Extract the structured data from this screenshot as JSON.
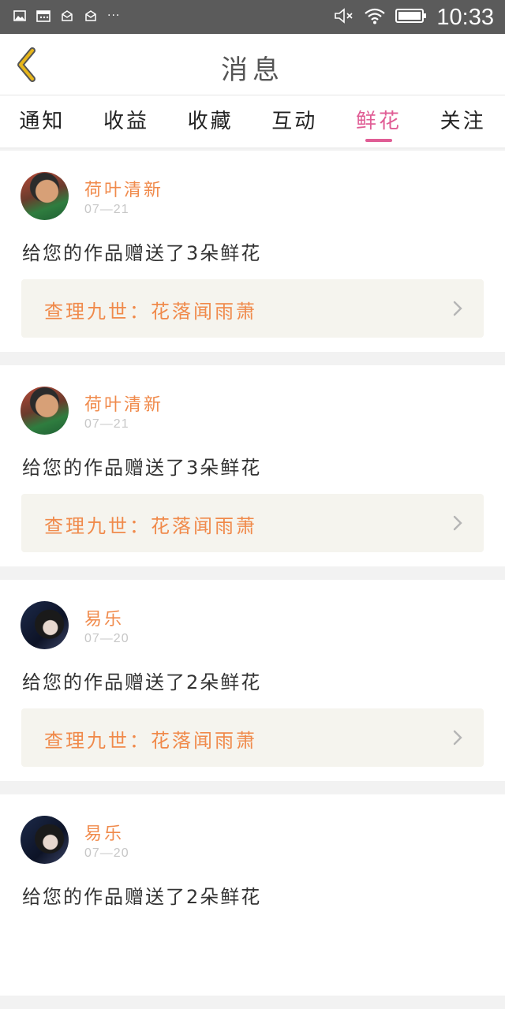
{
  "statusbar": {
    "time": "10:33",
    "dots": "···",
    "icons": [
      "image-icon",
      "calendar-icon",
      "mail-icon",
      "mail-icon",
      "mute-icon",
      "wifi-icon",
      "battery-icon"
    ]
  },
  "header": {
    "title": "消息"
  },
  "tabs": [
    {
      "label": "通知"
    },
    {
      "label": "收益"
    },
    {
      "label": "收藏"
    },
    {
      "label": "互动"
    },
    {
      "label": "鲜花"
    },
    {
      "label": "关注"
    }
  ],
  "active_tab": "鲜花",
  "items": [
    {
      "name": "荷叶清新",
      "date": "07—21",
      "message": "给您的作品赠送了3朵鲜花",
      "work": "查理九世：花落闻雨萧"
    },
    {
      "name": "荷叶清新",
      "date": "07—21",
      "message": "给您的作品赠送了3朵鲜花",
      "work": "查理九世：花落闻雨萧"
    },
    {
      "name": "易乐",
      "date": "07—20",
      "message": "给您的作品赠送了2朵鲜花",
      "work": "查理九世：花落闻雨萧"
    },
    {
      "name": "易乐",
      "date": "07—20",
      "message": "给您的作品赠送了2朵鲜花",
      "work": ""
    }
  ],
  "colors": {
    "accent": "#e05d95",
    "name": "#f08a4b",
    "back_icon": "#e7b61a"
  }
}
